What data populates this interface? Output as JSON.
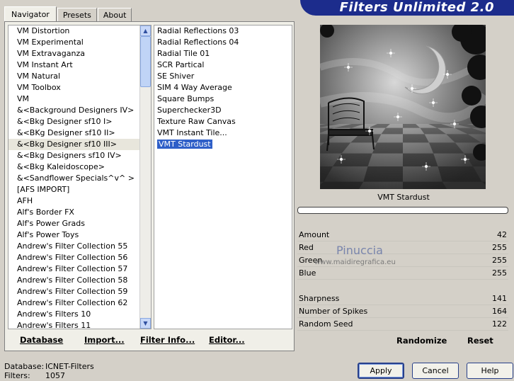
{
  "app": {
    "title": "Filters Unlimited 2.0"
  },
  "tabs": [
    {
      "label": "Navigator",
      "active": true
    },
    {
      "label": "Presets",
      "active": false
    },
    {
      "label": "About",
      "active": false
    }
  ],
  "categories": [
    "VM Distortion",
    "VM Experimental",
    "VM Extravaganza",
    "VM Instant Art",
    "VM Natural",
    "VM Toolbox",
    "VM",
    "&<Background Designers IV>",
    "&<Bkg Designer sf10 I>",
    "&<BKg Designer sf10 II>",
    "&<Bkg Designer sf10 III>",
    "&<Bkg Designers sf10 IV>",
    "&<Bkg Kaleidoscope>",
    "&<Sandflower Specials^v^ >",
    "[AFS IMPORT]",
    "AFH",
    "Alf's Border FX",
    "Alf's Power Grads",
    "Alf's Power Toys",
    "Andrew's Filter Collection 55",
    "Andrew's Filter Collection 56",
    "Andrew's Filter Collection 57",
    "Andrew's Filter Collection 58",
    "Andrew's Filter Collection 59",
    "Andrew's Filter Collection 62",
    "Andrew's Filters 10",
    "Andrew's Filters 11"
  ],
  "highlighted_category": "&<Bkg Designer sf10 III>",
  "filters": [
    "Radial Reflections 03",
    "Radial Reflections 04",
    "Radial Tile 01",
    "SCR  Partical",
    "SE Shiver",
    "SIM 4 Way Average",
    "Square Bumps",
    "Superchecker3D",
    "Texture Raw Canvas",
    "VMT Instant Tile...",
    "VMT Stardust"
  ],
  "selected_filter": "VMT Stardust",
  "left_buttons": [
    "Database",
    "Import...",
    "Filter Info...",
    "Editor..."
  ],
  "filter_name": "VMT Stardust",
  "params": [
    {
      "label": "Amount",
      "value": "42"
    },
    {
      "label": "Red",
      "value": "255"
    },
    {
      "label": "Green",
      "value": "255"
    },
    {
      "label": "Blue",
      "value": "255"
    },
    {
      "label": "Sharpness",
      "value": "141"
    },
    {
      "label": "Number of Spikes",
      "value": "164"
    },
    {
      "label": "Random Seed",
      "value": "122"
    }
  ],
  "watermark": {
    "text": "Pinuccia",
    "url": "www.maidiregrafica.eu"
  },
  "right_buttons": {
    "randomize": "Randomize",
    "reset": "Reset"
  },
  "status": {
    "database_label": "Database:",
    "database_value": "ICNET-Filters",
    "filters_label": "Filters:",
    "filters_value": "1057"
  },
  "dialog_buttons": {
    "apply": "Apply",
    "cancel": "Cancel",
    "help": "Help"
  }
}
